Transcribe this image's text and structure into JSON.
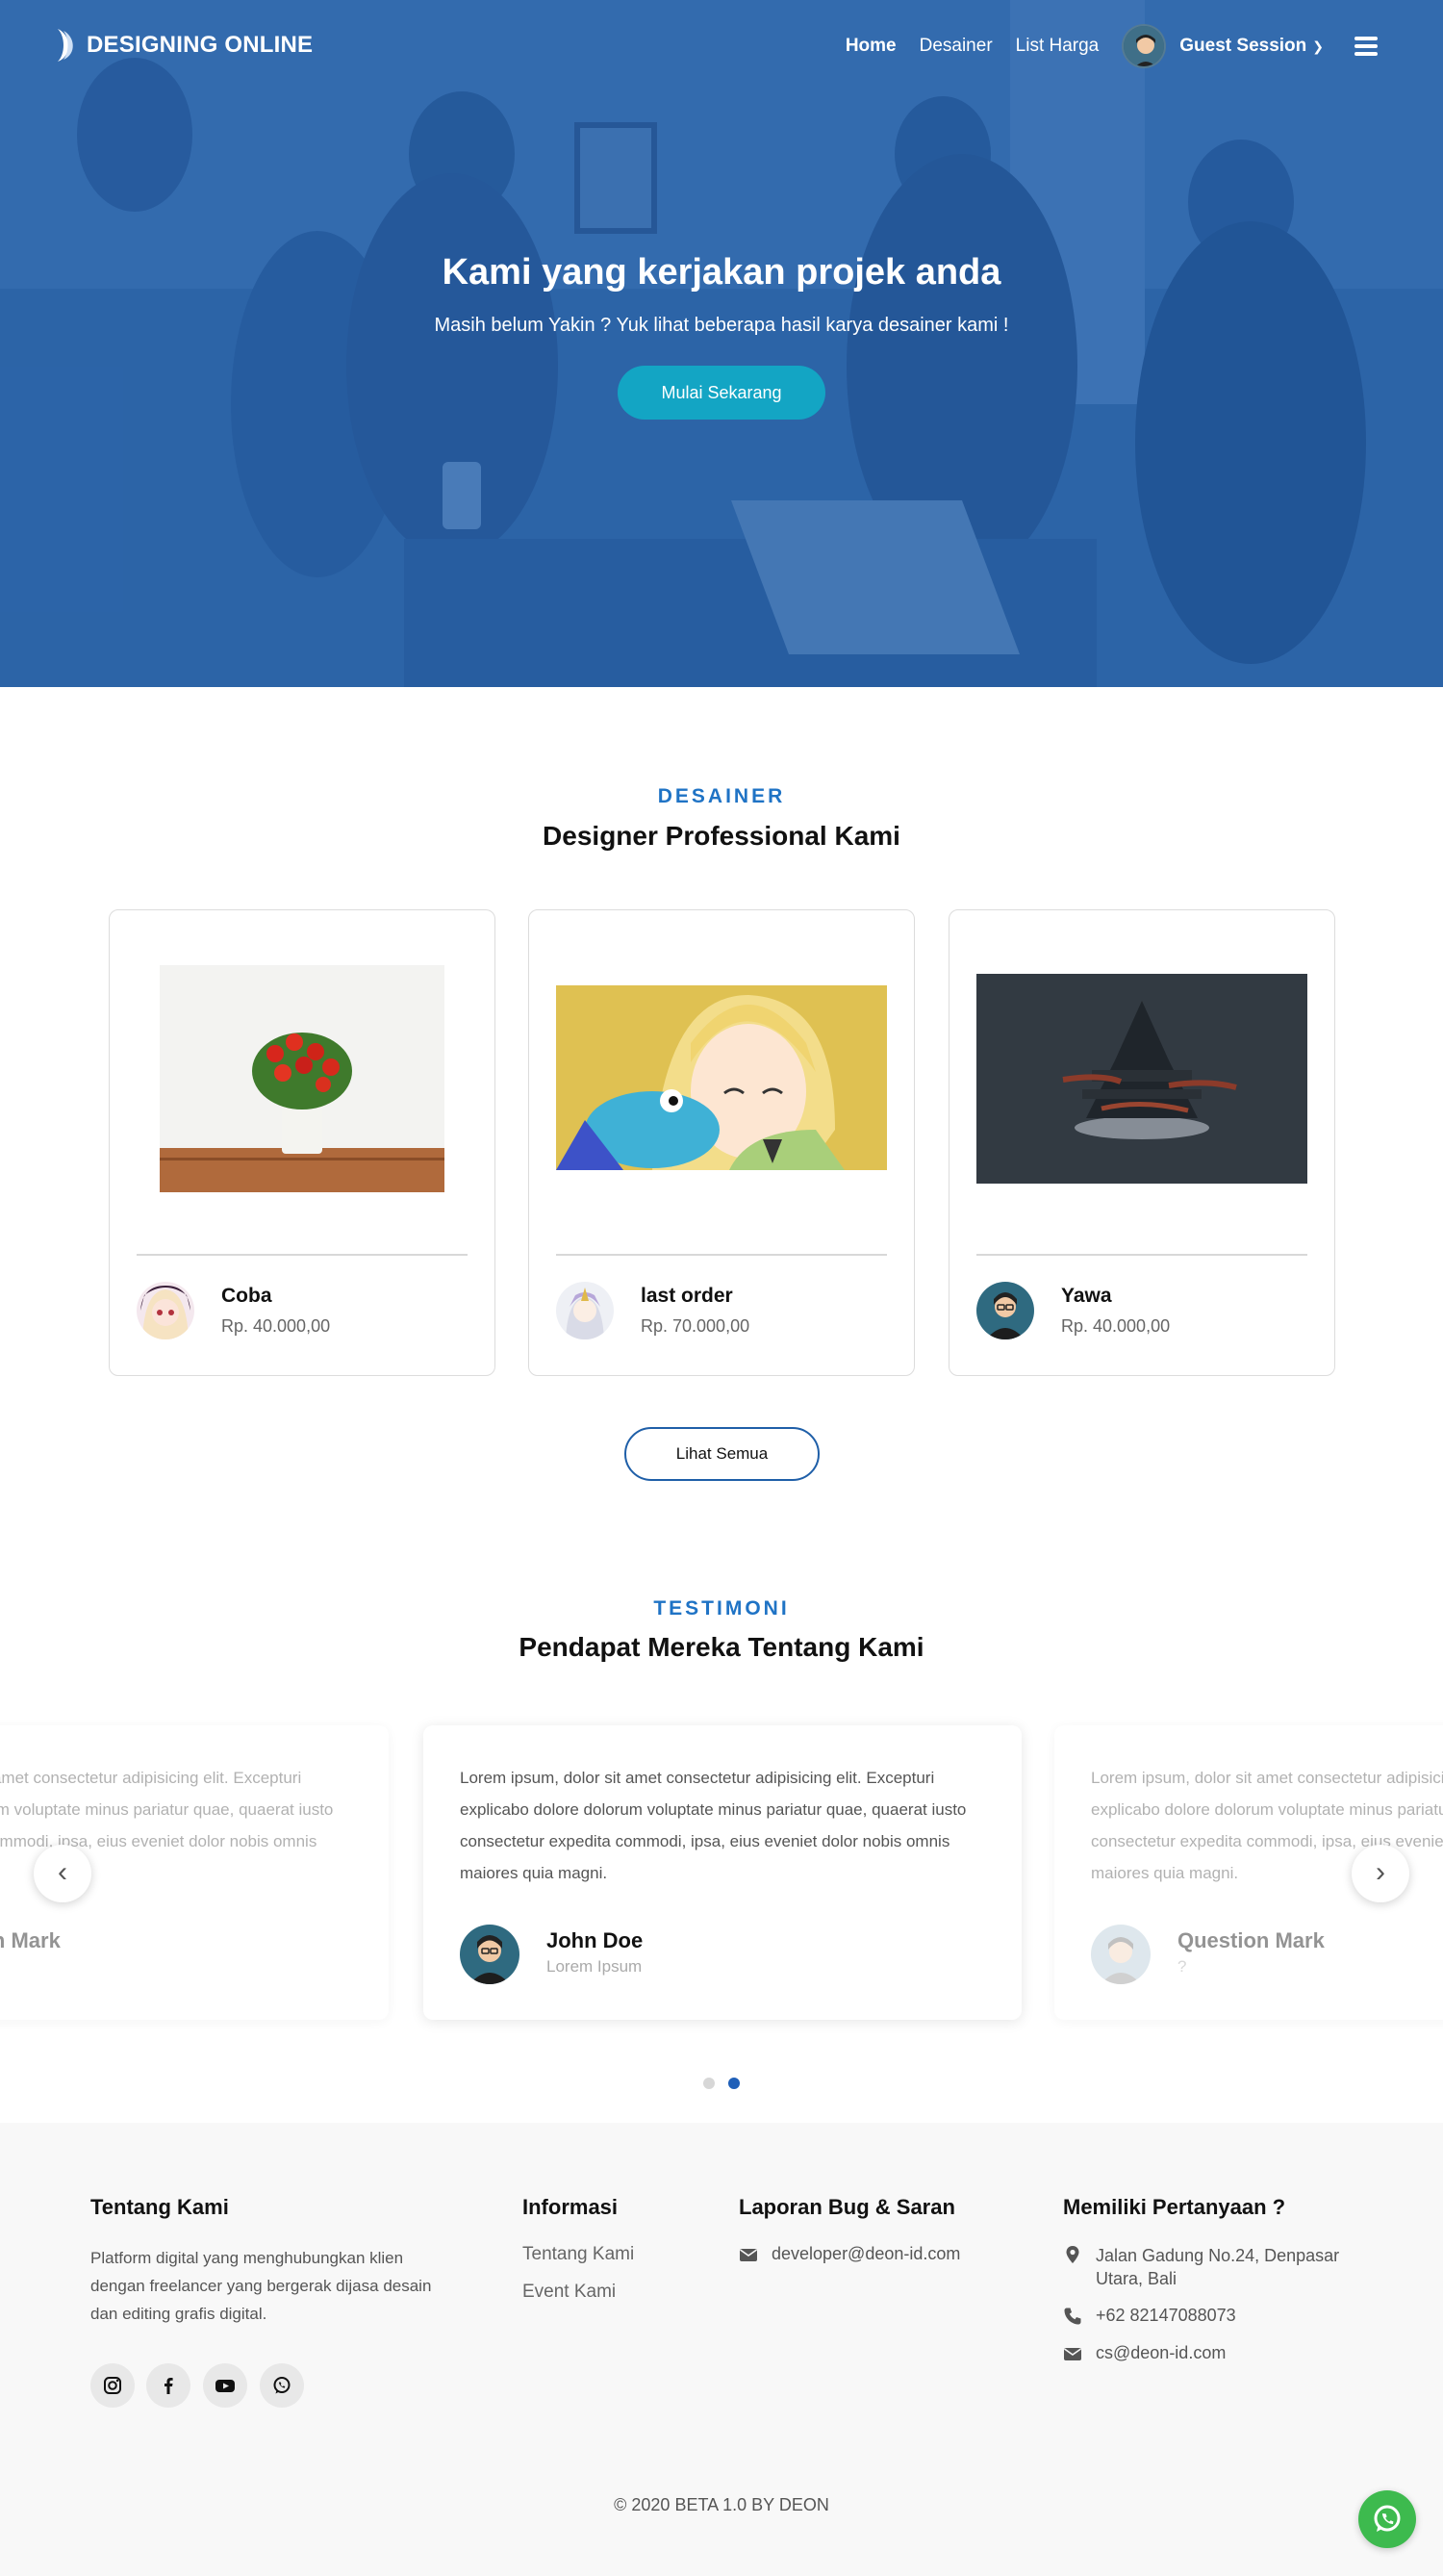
{
  "nav": {
    "brand": "DESIGNING ONLINE",
    "links": [
      "Home",
      "Desainer",
      "List Harga"
    ],
    "user": "Guest Session"
  },
  "hero": {
    "title": "Kami yang kerjakan projek anda",
    "subtitle": "Masih belum Yakin ? Yuk lihat beberapa hasil karya desainer kami !",
    "button": "Mulai Sekarang"
  },
  "designers": {
    "eyebrow": "DESAINER",
    "title": "Designer Professional Kami",
    "cards": [
      {
        "name": "Coba",
        "price": "Rp. 40.000,00"
      },
      {
        "name": "last order",
        "price": "Rp. 70.000,00"
      },
      {
        "name": "Yawa",
        "price": "Rp. 40.000,00"
      }
    ],
    "button": "Lihat Semua"
  },
  "testimoni": {
    "eyebrow": "TESTIMONI",
    "title": "Pendapat Mereka Tentang Kami",
    "items": [
      {
        "text": "Lorem ipsum, dolor sit amet consectetur adipisicing elit. Excepturi explicabo dolore dolorum voluptate minus pariatur quae, quaerat iusto consectetur expedita commodi, ipsa, eius eveniet dolor nobis omnis maiores quia magni.",
        "name": "Question Mark",
        "role": "?"
      },
      {
        "text": "Lorem ipsum, dolor sit amet consectetur adipisicing elit. Excepturi explicabo dolore dolorum voluptate minus pariatur quae, quaerat iusto consectetur expedita commodi, ipsa, eius eveniet dolor nobis omnis maiores quia magni.",
        "name": "John Doe",
        "role": "Lorem Ipsum"
      },
      {
        "text": "Lorem ipsum, dolor sit amet consectetur adipisicing elit. Excepturi explicabo dolore dolorum voluptate minus pariatur quae, quaerat iusto consectetur expedita commodi, ipsa, eius eveniet dolor nobis omnis maiores quia magni.",
        "name": "Question Mark",
        "role": "?"
      }
    ]
  },
  "footer": {
    "about_title": "Tentang Kami",
    "about_text": "Platform digital yang menghubungkan klien dengan freelancer yang bergerak dijasa desain dan editing grafis digital.",
    "info_title": "Informasi",
    "info_links": [
      "Tentang Kami",
      "Event Kami"
    ],
    "bug_title": "Laporan Bug & Saran",
    "bug_email": "developer@deon-id.com",
    "contact_title": "Memiliki Pertanyaan ?",
    "address": "Jalan Gadung No.24, Denpasar Utara, Bali",
    "phone": "+62 82147088073",
    "email": "cs@deon-id.com",
    "copyright": "© 2020 BETA 1.0 BY DEON"
  },
  "colors": {
    "accent": "#1f73c5",
    "hero_button": "#13a5c4",
    "whatsapp": "#3dba4e"
  }
}
